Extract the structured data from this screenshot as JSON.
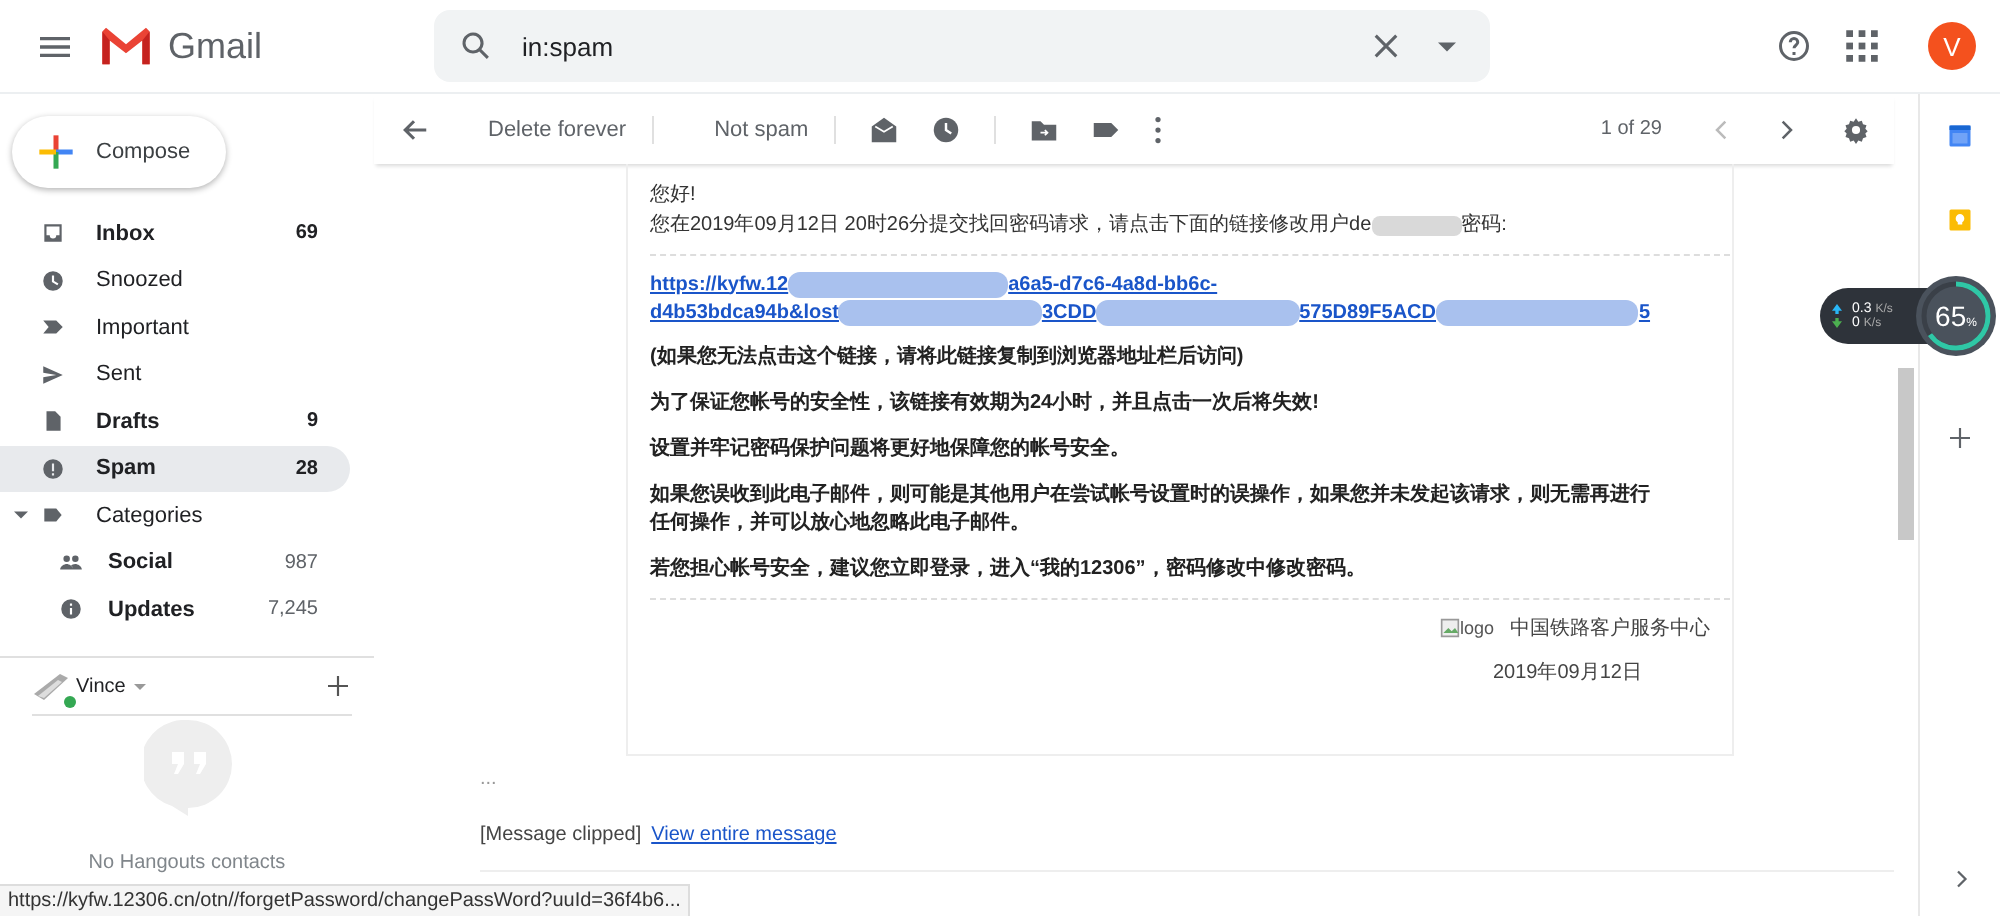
{
  "header": {
    "app_name": "Gmail",
    "search": {
      "value": "in:spam"
    },
    "avatar": "V"
  },
  "compose": "Compose",
  "sidebar": {
    "items": [
      {
        "label": "Inbox",
        "count": "69",
        "unread": true,
        "selected": false
      },
      {
        "label": "Snoozed",
        "unread": false,
        "selected": false
      },
      {
        "label": "Important",
        "unread": false,
        "selected": false
      },
      {
        "label": "Sent",
        "unread": false,
        "selected": false
      },
      {
        "label": "Drafts",
        "count": "9",
        "unread": true,
        "selected": false
      },
      {
        "label": "Spam",
        "count": "28",
        "unread": true,
        "selected": true
      },
      {
        "label": "Categories",
        "unread": false,
        "selected": false,
        "expanded": true,
        "children": [
          {
            "label": "Social",
            "count": "987",
            "unread": true,
            "selected": false
          },
          {
            "label": "Updates",
            "count": "7,245",
            "unread": true,
            "selected": false
          }
        ]
      }
    ]
  },
  "hangouts": {
    "user": "Vince",
    "online": true,
    "empty": "No Hangouts contacts"
  },
  "toolbar": {
    "buttons": [
      "Delete forever",
      "Not spam"
    ],
    "pager": "1 of 29"
  },
  "message": {
    "greeting": "您好!",
    "intro": "您在2019年09月12日 20时26分提交找回密码请求，请点击下面的链接修改用户de",
    "intro_end": "密码:",
    "link_lines": [
      [
        "https://kyfw.12",
        "a6a5-d7c6-4a8d-bb6c-"
      ],
      [
        "d4b53bdca94b&lost",
        "3CDD",
        "575D89F5ACD",
        "5"
      ]
    ],
    "paragraphs": [
      "(如果您无法点击这个链接，请将此链接复制到浏览器地址栏后访问)",
      "为了保证您帐号的安全性，该链接有效期为24小时，并且点击一次后将失效!",
      "设置并牢记密码保护问题将更好地保障您的帐号安全。",
      "如果您误收到此电子邮件，则可能是其他用户在尝试帐号设置时的误操作，如果您并未发起该请求，则无需再进行任何操作，并可以放心地忽略此电子邮件。",
      "若您担心帐号安全，建议您立即登录，进入“我的12306”，密码修改中修改密码。"
    ],
    "signature": {
      "logo_alt": "logo",
      "org": "中国铁路客户服务中心",
      "date": "2019年09月12日"
    },
    "ellipsis": "...",
    "clipped": "[Message clipped]",
    "view_link": "View entire message"
  },
  "status_url": "https://kyfw.12306.cn/otn//forgetPassword/changePassWord?uuId=36f4b6...",
  "net_widget": {
    "up": "0.3",
    "up_unit": "K/s",
    "down": "0",
    "down_unit": "K/s",
    "percent": "65",
    "percent_sign": "%",
    "level": 0.65
  }
}
